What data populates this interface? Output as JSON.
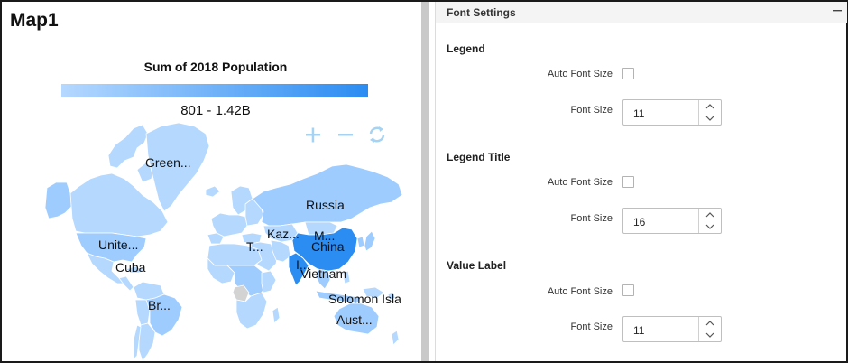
{
  "map": {
    "title": "Map1",
    "legend_title": "Sum of 2018 Population",
    "legend_range": "801 - 1.42B",
    "colors": {
      "light": "#b5d8ff",
      "mid": "#9fccff",
      "dark": "#2b8cf2",
      "ocean": "#ffffff",
      "nodata": "#d3d3d3",
      "control": "#9fd1f5"
    },
    "labels": [
      {
        "text": "Green..."
      },
      {
        "text": "Russia"
      },
      {
        "text": "Unite..."
      },
      {
        "text": "Kaz..."
      },
      {
        "text": "M..."
      },
      {
        "text": "China"
      },
      {
        "text": "T..."
      },
      {
        "text": "I..."
      },
      {
        "text": "Vietnam"
      },
      {
        "text": "Cuba"
      },
      {
        "text": "Br..."
      },
      {
        "text": "Solomon Isla"
      },
      {
        "text": "Aust..."
      }
    ],
    "controls": {
      "zoom_in_icon": "plus-icon",
      "zoom_out_icon": "minus-icon",
      "reset_icon": "refresh-icon"
    }
  },
  "settings": {
    "header": "Font Settings",
    "collapse_icon": "minus-icon",
    "sections": [
      {
        "title": "Legend",
        "auto_font_size_label": "Auto Font Size",
        "auto_font_size_checked": false,
        "font_size_label": "Font Size",
        "font_size": "11"
      },
      {
        "title": "Legend Title",
        "auto_font_size_label": "Auto Font Size",
        "auto_font_size_checked": false,
        "font_size_label": "Font Size",
        "font_size": "16"
      },
      {
        "title": "Value Label",
        "auto_font_size_label": "Auto Font Size",
        "auto_font_size_checked": false,
        "font_size_label": "Font Size",
        "font_size": "11"
      }
    ]
  }
}
